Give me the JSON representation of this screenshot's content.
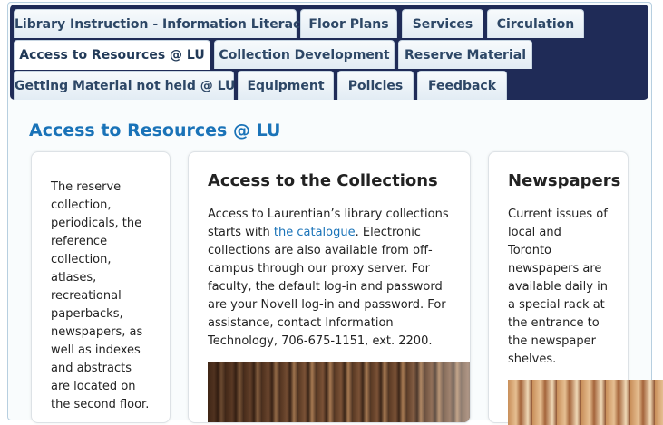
{
  "tabs": {
    "library_instruction": "Library Instruction - Information Literacy",
    "floor_plans": "Floor Plans",
    "services": "Services",
    "circulation": "Circulation",
    "access_resources": "Access to Resources @ LU",
    "collection_development": "Collection Development",
    "reserve_material": "Reserve Material",
    "getting_material": "Getting Material not held @ LU",
    "equipment": "Equipment",
    "policies": "Policies",
    "feedback": "Feedback",
    "active": "Access to Resources @ LU"
  },
  "page_title": "Access to Resources @ LU",
  "cards": {
    "reserve_location": {
      "body_lines": [
        "The reserve",
        "collection,",
        "periodicals, the",
        "reference",
        "collection,",
        "atlases,",
        "recreational",
        "paperbacks,",
        "newspapers, as",
        "well as indexes",
        "and abstracts",
        "are located on",
        "the second floor."
      ]
    },
    "collections": {
      "title": "Access to the Collections",
      "line1": "Access to Laurentian’s library collections",
      "line2_before": "starts with ",
      "catalogue_link": "the catalogue",
      "line2_after": ". Electronic",
      "lines_rest": [
        "collections are also available from off-",
        "campus through our proxy server. For",
        "faculty, the default log-in and password",
        "are your Novell log-in and password. For",
        "assistance, contact Information",
        "Technology, 706-675-1151, ext. 2200."
      ]
    },
    "newspapers": {
      "title": "Newspapers",
      "body_lines": [
        "Current issues of",
        "local and",
        "Toronto",
        "newspapers are",
        "available daily in",
        "a special rack at",
        "the entrance to",
        "the newspaper",
        "shelves."
      ]
    }
  }
}
